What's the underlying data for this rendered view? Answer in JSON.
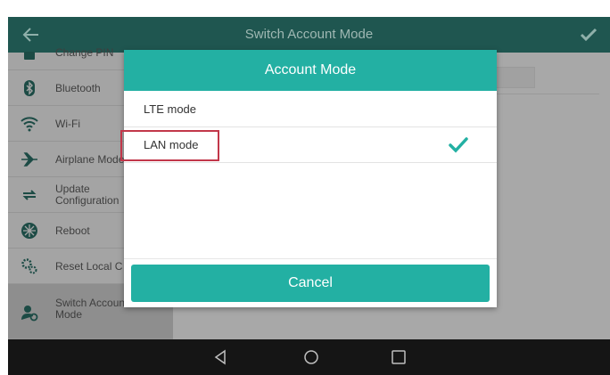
{
  "header": {
    "title": "Switch Account Mode"
  },
  "sidebar": {
    "items": [
      {
        "label": "Change PIN",
        "icon": "lock-icon"
      },
      {
        "label": "Bluetooth",
        "icon": "bluetooth-icon"
      },
      {
        "label": "Wi-Fi",
        "icon": "wifi-icon"
      },
      {
        "label": "Airplane Mode",
        "icon": "airplane-icon"
      },
      {
        "label": "Update\nConfiguration",
        "icon": "sync-icon"
      },
      {
        "label": "Reboot",
        "icon": "reboot-icon"
      },
      {
        "label": "Reset Local C",
        "icon": "reset-icon"
      },
      {
        "label": "Switch Account\nMode",
        "icon": "switch-account-icon",
        "selected": true
      }
    ]
  },
  "dialog": {
    "title": "Account Mode",
    "options": [
      {
        "label": "LTE mode",
        "checked": false
      },
      {
        "label": "LAN mode",
        "checked": true
      }
    ],
    "cancel_label": "Cancel"
  },
  "colors": {
    "accent": "#23b0a3",
    "topbar": "#1f5650",
    "highlight": "#c2374a",
    "navbar": "#151515"
  }
}
